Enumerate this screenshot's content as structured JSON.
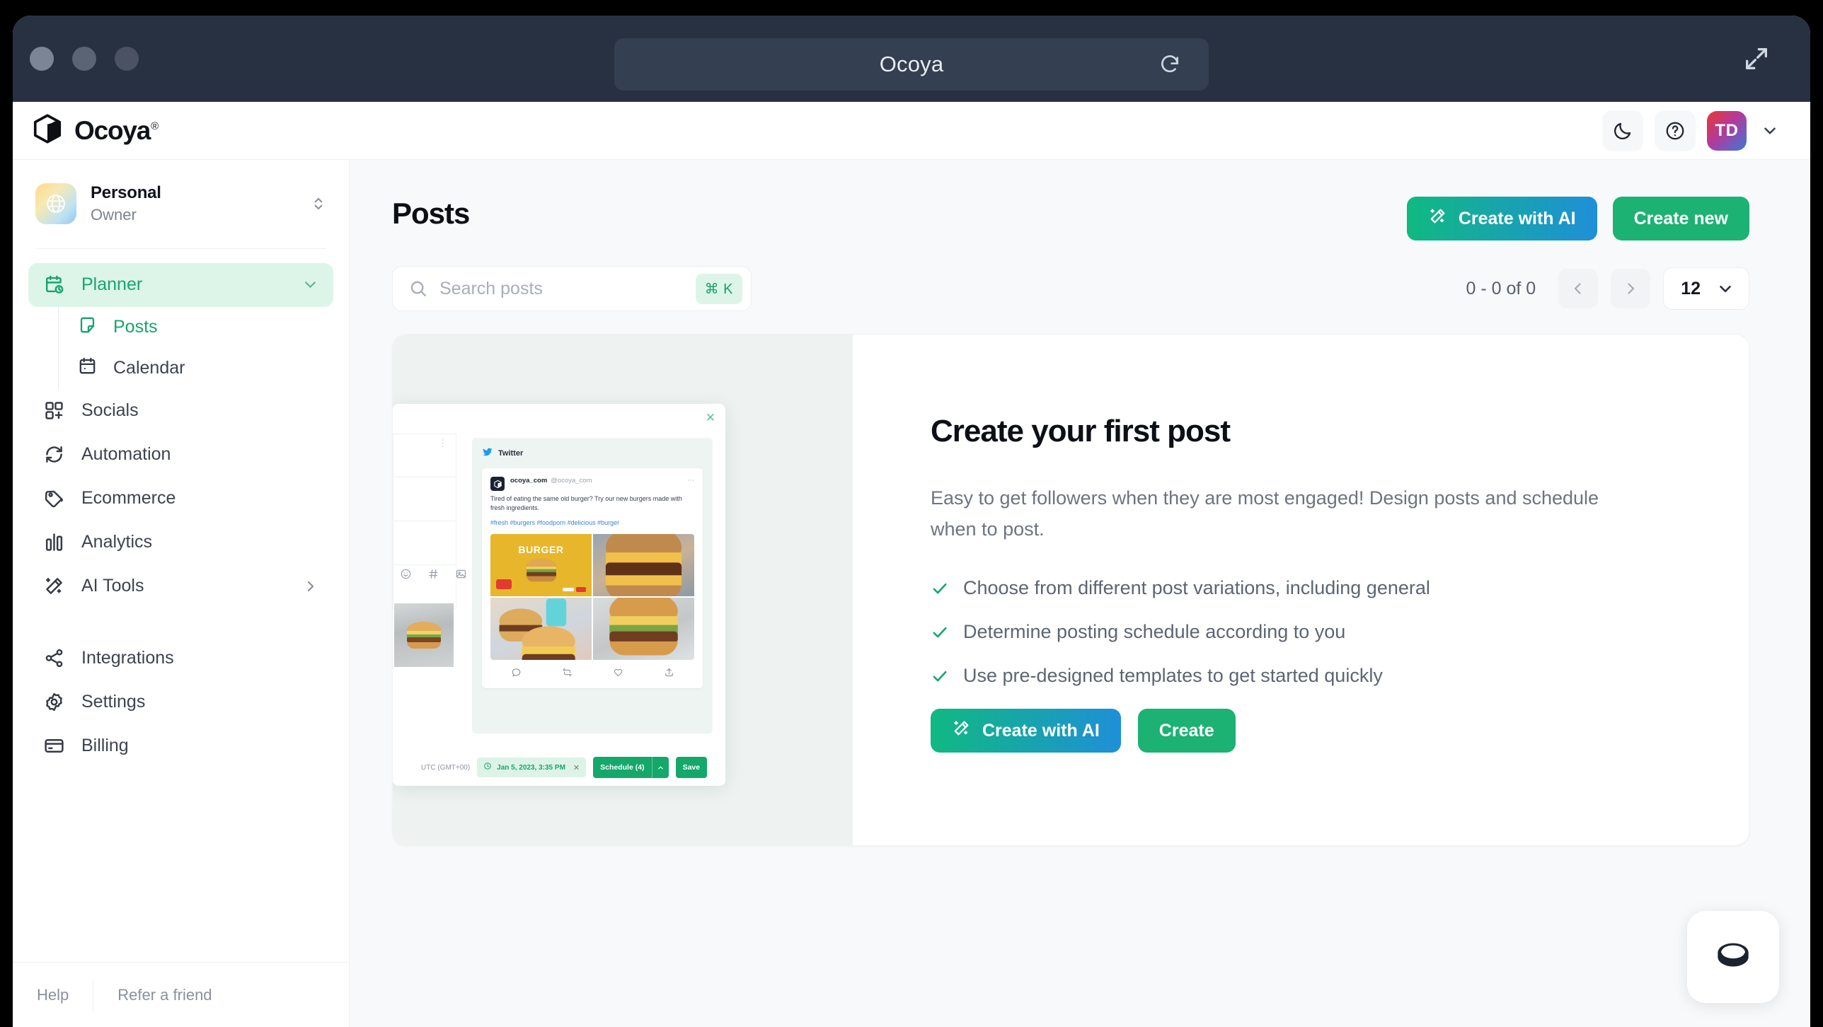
{
  "window": {
    "url_title": "Ocoya",
    "reload_icon": "reload-icon",
    "expand_icon": "expand-icon"
  },
  "header": {
    "brand_name": "Ocoya",
    "brand_reg": "®",
    "dark_mode_icon": "moon-icon",
    "help_icon": "question-circle-icon",
    "avatar_initials": "TD",
    "avatar_caret_icon": "chevron-down-icon"
  },
  "sidebar": {
    "workspace": {
      "name": "Personal",
      "role": "Owner",
      "avatar_icon": "globe-icon",
      "switch_icon": "chevron-up-down-icon"
    },
    "nav": [
      {
        "label": "Planner",
        "icon": "calendar-clock-icon",
        "active": true,
        "caret": "chevron-down-icon"
      },
      {
        "label": "Socials",
        "icon": "grid-plus-icon",
        "active": false
      },
      {
        "label": "Automation",
        "icon": "refresh-icon",
        "active": false
      },
      {
        "label": "Ecommerce",
        "icon": "tag-icon",
        "active": false
      },
      {
        "label": "Analytics",
        "icon": "bar-chart-icon",
        "active": false
      },
      {
        "label": "AI Tools",
        "icon": "magic-wand-icon",
        "active": false,
        "caret": "chevron-right-icon"
      },
      {
        "label": "Integrations",
        "icon": "share-nodes-icon",
        "active": false
      },
      {
        "label": "Settings",
        "icon": "gear-icon",
        "active": false
      },
      {
        "label": "Billing",
        "icon": "credit-card-icon",
        "active": false
      }
    ],
    "subnav": [
      {
        "label": "Posts",
        "icon": "note-icon",
        "current": true
      },
      {
        "label": "Calendar",
        "icon": "calendar-icon",
        "current": false
      }
    ],
    "footer": {
      "help": "Help",
      "refer": "Refer a friend"
    }
  },
  "main": {
    "page_title": "Posts",
    "create_with_ai_label": "Create with AI",
    "create_new_label": "Create new",
    "magic_wand_icon": "magic-wand-icon",
    "search": {
      "placeholder": "Search posts",
      "value": "",
      "icon": "search-icon",
      "shortcut": "⌘ K"
    },
    "pagination": {
      "count_text": "0 - 0 of 0",
      "prev_icon": "chevron-left-icon",
      "next_icon": "chevron-right-icon",
      "page_size": "12",
      "page_size_caret": "chevron-down-icon"
    },
    "empty_state": {
      "title": "Create your first post",
      "description": "Easy to get followers when they are most engaged! Design posts and schedule when to post.",
      "bullets": [
        "Choose from different post variations, including general",
        "Determine posting schedule according to you",
        "Use pre-designed templates to get started quickly"
      ],
      "primary_label": "Create with AI",
      "secondary_label": "Create",
      "check_icon": "check-icon"
    },
    "illustration": {
      "close_icon": "close-icon",
      "network_label": "Twitter",
      "twitter_icon": "twitter-bird-icon",
      "account_name": "ocoya_com",
      "account_handle": "@ocoya_com",
      "more_icon": "ellipsis-icon",
      "tweet_text": "Tired of eating the same old burger? Try our new burgers made with fresh ingredients.",
      "tweet_tags": "#fresh #burgers #foodporn #delicious #burger",
      "poster_label": "BURGER",
      "actions": [
        "reply-icon",
        "retweet-icon",
        "like-icon",
        "share-icon"
      ],
      "timezone": "UTC (GMT+00)",
      "schedule_date": "Jan 5, 2023, 3:35 PM",
      "clock_icon": "clock-icon",
      "remove_icon": "close-icon",
      "schedule_label": "Schedule (4)",
      "schedule_caret": "chevron-up-icon",
      "save_label": "Save",
      "toolbar_icons": [
        "emoji-icon",
        "hashtag-icon",
        "image-icon"
      ]
    }
  },
  "chat_widget": {
    "icon": "chat-bubble-icon"
  }
}
